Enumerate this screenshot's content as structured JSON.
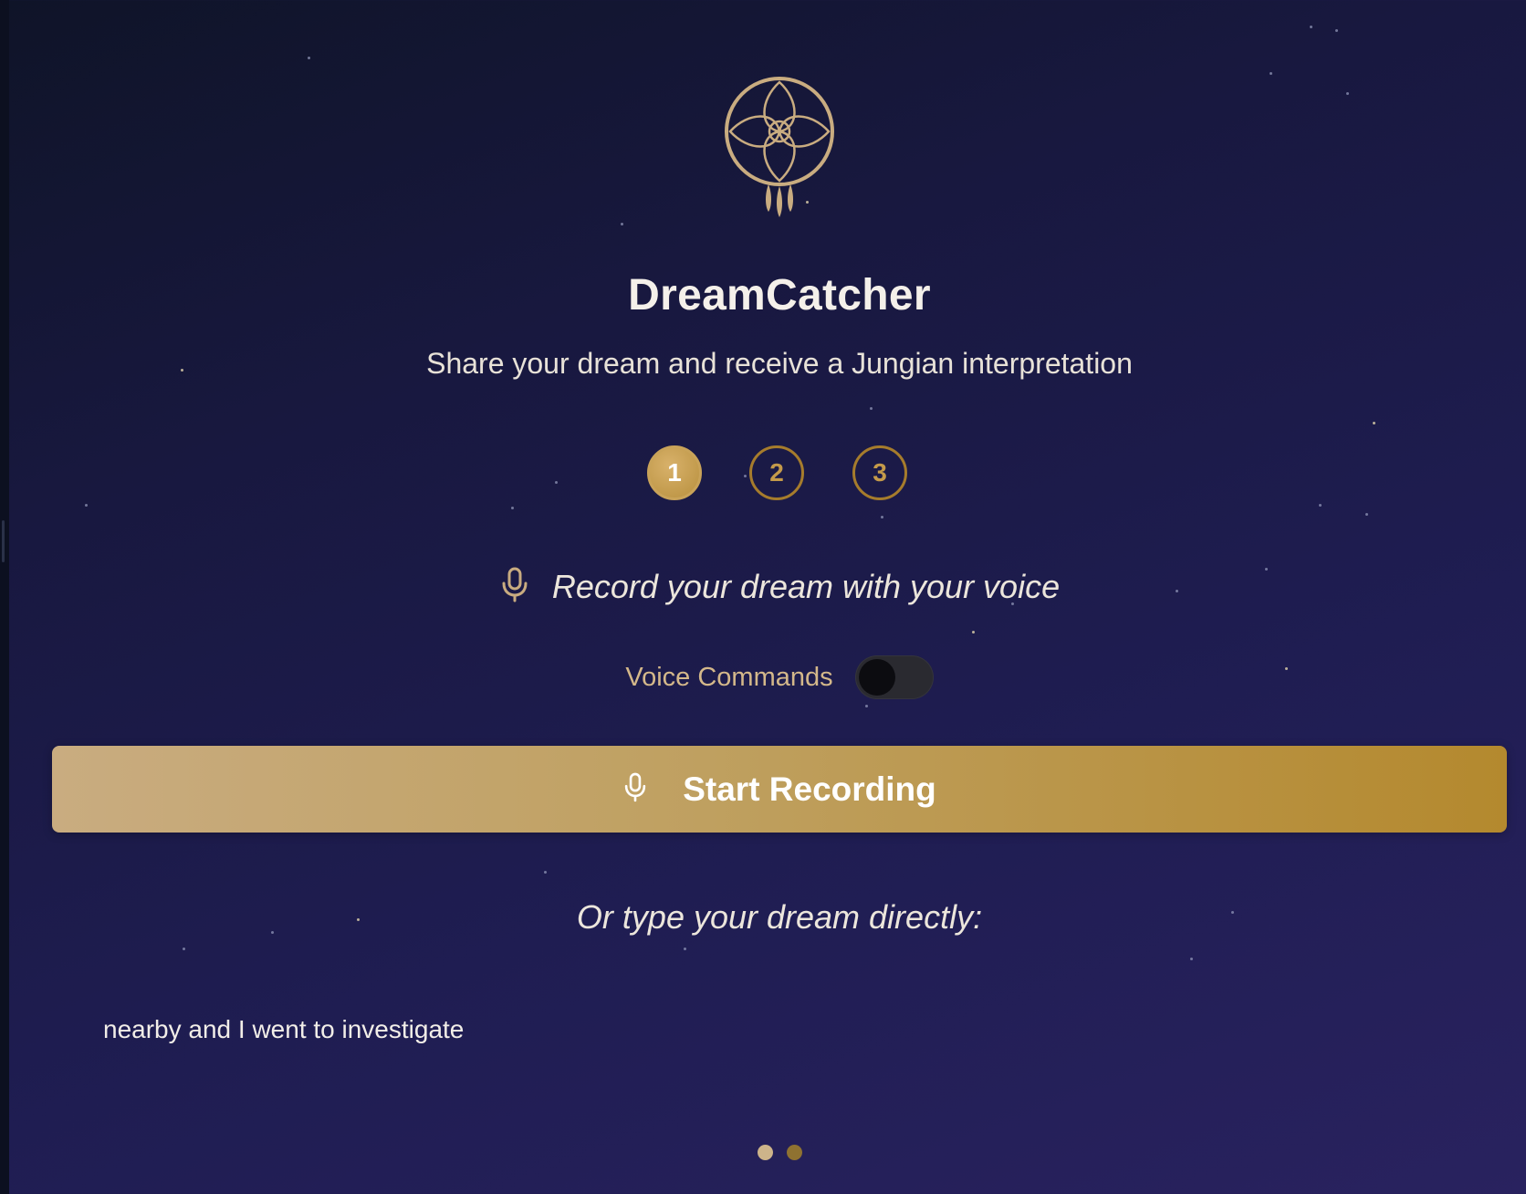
{
  "app": {
    "title": "DreamCatcher",
    "subtitle": "Share your dream and receive a Jungian interpretation",
    "logo_icon": "dreamcatcher-icon"
  },
  "steps": {
    "items": [
      "1",
      "2",
      "3"
    ],
    "active": "1"
  },
  "recording": {
    "prompt": "Record your dream with your voice",
    "prompt_icon": "microphone-icon",
    "voice_commands_label": "Voice Commands",
    "voice_commands_enabled": false,
    "button_label": "Start Recording",
    "button_icon": "microphone-icon"
  },
  "typing": {
    "prompt": "Or type your dream directly:",
    "dream_text": "nearby and I went to investigate"
  },
  "pager": {
    "pages": 2,
    "current": 1
  },
  "colors": {
    "gold_accent": "#b8903e",
    "background_dark": "#0f1428",
    "background_light": "#29225f"
  }
}
